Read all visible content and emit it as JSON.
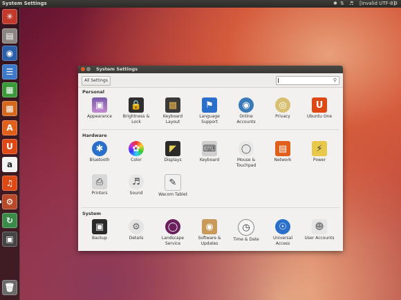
{
  "topbar": {
    "title": "System Settings",
    "keyboard_indicator": "[Invalid UTF-8]"
  },
  "window": {
    "title": "System Settings"
  },
  "toolbar": {
    "all_settings_label": "All Settings"
  },
  "sections": {
    "personal": "Personal",
    "hardware": "Hardware",
    "system": "System"
  },
  "items": {
    "appearance": "Appearance",
    "brightness": "Brightness &\nLock",
    "keyboard_layout": "Keyboard\nLayout",
    "language": "Language\nSupport",
    "online_accounts": "Online\nAccounts",
    "privacy": "Privacy",
    "ubuntu_one": "Ubuntu One",
    "bluetooth": "Bluetooth",
    "color": "Color",
    "displays": "Displays",
    "keyboard": "Keyboard",
    "mouse": "Mouse &\nTouchpad",
    "network": "Network",
    "power": "Power",
    "printers": "Printers",
    "sound": "Sound",
    "wacom": "Wacom Tablet",
    "backup": "Backup",
    "details": "Details",
    "landscape": "Landscape\nService",
    "software": "Software &\nUpdates",
    "time": "Time & Date",
    "universal": "Universal\nAccess",
    "user_accounts": "User Accounts"
  },
  "colors": {
    "ubuntu_orange": "#dd4814",
    "bluetooth_blue": "#2a6fc9",
    "landscape_purple": "#6b1f5d"
  }
}
